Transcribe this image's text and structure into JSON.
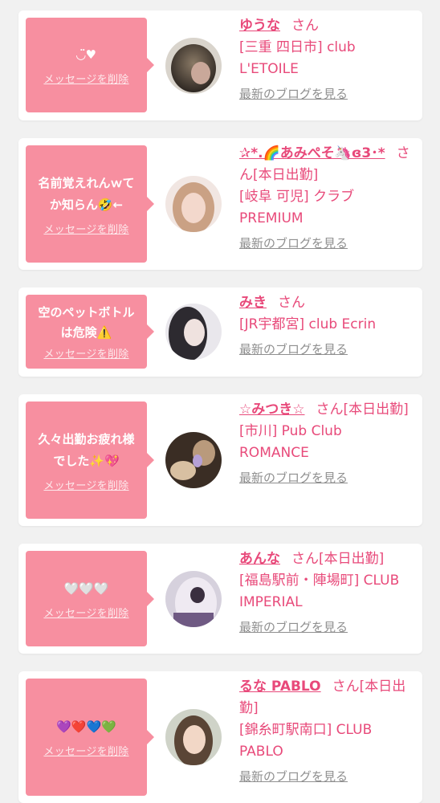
{
  "delete_label": "メッセージを削除",
  "blog_label": "最新のブログを見る",
  "san_label": "さん",
  "messages": [
    {
      "text": "◡̈♥",
      "name": "ゆうな",
      "suffix": "",
      "shop_lines": [
        "[三重 四日市] club",
        "L'ETOILE"
      ],
      "avatar_icon": "avatar-photo"
    },
    {
      "text": "名前覚えれんｗてか知らん🤣←",
      "name": "✰*.🌈あみぺそ🦄ɞ3･*",
      "suffix": "さん[本日出勤]",
      "shop_lines": [
        "[岐阜 可児] クラブ",
        "PREMIUM"
      ],
      "avatar_icon": "avatar-photo"
    },
    {
      "text": "空のペットボトルは危険⚠️",
      "name": "みき",
      "suffix": "",
      "shop_lines": [
        "[JR宇都宮] club Ecrin"
      ],
      "avatar_icon": "avatar-photo"
    },
    {
      "text": "久々出勤お疲れ様でした✨💖",
      "name": "☆みつき☆",
      "suffix": "さん[本日出勤]",
      "shop_lines": [
        "[市川] Pub Club",
        "ROMANCE"
      ],
      "avatar_icon": "avatar-photo"
    },
    {
      "text": "🤍🤍🤍",
      "name": "あんな",
      "suffix": "さん[本日出勤]",
      "shop_lines": [
        "[福島駅前・陣場町] CLUB",
        "IMPERIAL"
      ],
      "avatar_icon": "avatar-photo"
    },
    {
      "text": "💜❤️💙💚",
      "name": "るな PABLO",
      "suffix": "さん[本日出勤]",
      "shop_lines": [
        "[錦糸町駅南口] CLUB",
        "PABLO"
      ],
      "avatar_icon": "avatar-photo"
    }
  ],
  "colors": {
    "bubble": "#f78fa0",
    "name": "#e8497a",
    "blog_link": "#8f8f8f",
    "background": "#f1f1f1"
  }
}
